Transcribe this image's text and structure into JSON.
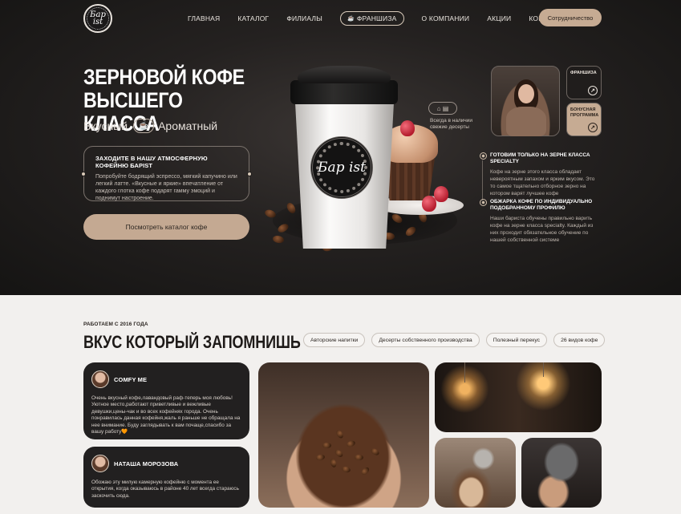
{
  "header": {
    "logo_text": "Бар ist",
    "nav": [
      "ГЛАВНАЯ",
      "КАТАЛОГ",
      "ФИЛИАЛЫ",
      "ФРАНШИЗА",
      "О КОМПАНИИ",
      "АКЦИИ",
      "КОНТАКТЫ"
    ],
    "collab_button": "Сотрудничество"
  },
  "hero": {
    "title_line1": "ЗЕРНОВОЙ КОФЕ",
    "title_line2": "ВЫСШЕГО КЛАССА",
    "sub_left": "Вкусный",
    "sub_right": "Ароматный",
    "card_title": "ЗАХОДИТЕ В НАШУ АТМОСФЕРНУЮ КОФЕЙНЮ БАРIST",
    "card_text": "Попробуйте бодрящий эспрессо, мягкий капучино или легкий латте. «Вкусные и яркие» впечатление от каждого глотка кофе подарят гамму эмоций и поднимут настроение.",
    "catalog_button": "Посмотреть каталог кофе",
    "cup_logo": "Бар ist",
    "dessert_note": "Всегда в наличии свежие десерты",
    "side_card_1": "ФРАНШИЗА",
    "side_card_2": "БОНУСНАЯ ПРОГРАММА",
    "features": [
      {
        "title": "ГОТОВИМ ТОЛЬКО НА ЗЕРНЕ КЛАССА SPECIALTY",
        "text": "Кофе на зерне этого класса обладает невероятным запахом и ярким вкусом. Это то самое тщательно отборное зерно на котором варят лучшее кофе"
      },
      {
        "title": "ОБЖАРКА КОФЕ ПО ИНДИВИДУАЛЬНО ПОДОБРАННОМУ ПРОФИЛЮ",
        "text": "Наши бариста обучены правильно варить кофе на зерне класса specialty. Каждый из них проходит обязательное обучение по нашей собственной системе"
      }
    ]
  },
  "section": {
    "since": "РАБОТАЕМ С 2016 ГОДА",
    "title": "ВКУС КОТОРЫЙ ЗАПОМНИШЬ",
    "tags": [
      "Авторские напитки",
      "Десерты собственного производства",
      "Полезный перекус",
      "26 видов кофе"
    ],
    "reviews": [
      {
        "name": "COMFY ME",
        "text": "Очень вкусный кофе,лавандовый раф-теперь моя любовь! Уютное место,работают приветливые и вежливые девушки,цены-чак и во всех кофейнях города. Очень понравилась данная кофейня,жаль я раньше не обращала на нее внимание. Буду заглядывать к вам почаще,спасибо за вашу работу🧡"
      },
      {
        "name": "НАТАША МОРОЗОВА",
        "text": "Обожаю эту милую камерную кофейню с момента ее открытия, когда оказываюсь в районе 40 лет всегда стараюсь заскочить сюда."
      }
    ]
  },
  "colors": {
    "accent": "#c6ab93",
    "dark": "#222020",
    "light_bg": "#f2f0ee"
  }
}
